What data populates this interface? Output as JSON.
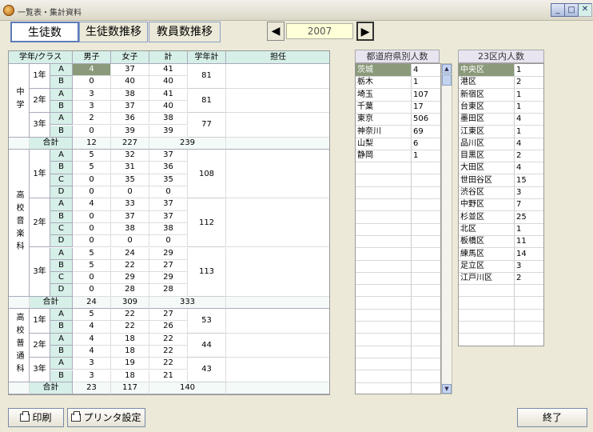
{
  "window": {
    "title": "一覧表・集計資料"
  },
  "tabs": [
    {
      "label": "生徒数"
    },
    {
      "label": "生徒数推移"
    },
    {
      "label": "教員数推移"
    }
  ],
  "year": {
    "value": "2007"
  },
  "grid": {
    "headers": {
      "year_class": "学年/クラス",
      "boys": "男子",
      "girls": "女子",
      "total": "計",
      "grade_total": "学年計",
      "teacher": "担任"
    },
    "sections": [
      {
        "label": "中学",
        "rows": [
          {
            "year": "1年",
            "class": "A",
            "boys": "4",
            "girls": "37",
            "total": "41"
          },
          {
            "year": "1年",
            "class": "B",
            "boys": "0",
            "girls": "40",
            "total": "40"
          },
          {
            "year": "2年",
            "class": "A",
            "boys": "3",
            "girls": "38",
            "total": "41"
          },
          {
            "year": "2年",
            "class": "B",
            "boys": "3",
            "girls": "37",
            "total": "40"
          },
          {
            "year": "3年",
            "class": "A",
            "boys": "2",
            "girls": "36",
            "total": "38"
          },
          {
            "year": "3年",
            "class": "B",
            "boys": "0",
            "girls": "39",
            "total": "39"
          }
        ],
        "grade_totals": [
          "81",
          "81",
          "77"
        ],
        "sum": {
          "label": "合計",
          "boys": "12",
          "girls": "227",
          "total": "239"
        }
      },
      {
        "label": "高校音楽科",
        "rows": [
          {
            "class": "A",
            "boys": "5",
            "girls": "32",
            "total": "37"
          },
          {
            "class": "B",
            "boys": "5",
            "girls": "31",
            "total": "36"
          },
          {
            "class": "C",
            "boys": "0",
            "girls": "35",
            "total": "35"
          },
          {
            "class": "D",
            "boys": "0",
            "girls": "0",
            "total": "0"
          },
          {
            "class": "A",
            "boys": "4",
            "girls": "33",
            "total": "37"
          },
          {
            "class": "B",
            "boys": "0",
            "girls": "37",
            "total": "37"
          },
          {
            "class": "C",
            "boys": "0",
            "girls": "38",
            "total": "38"
          },
          {
            "class": "D",
            "boys": "0",
            "girls": "0",
            "total": "0"
          },
          {
            "class": "A",
            "boys": "5",
            "girls": "24",
            "total": "29"
          },
          {
            "class": "B",
            "boys": "5",
            "girls": "22",
            "total": "27"
          },
          {
            "class": "C",
            "boys": "0",
            "girls": "29",
            "total": "29"
          },
          {
            "class": "D",
            "boys": "0",
            "girls": "28",
            "total": "28"
          }
        ],
        "years": [
          "1年",
          "2年",
          "3年"
        ],
        "grade_totals": [
          "108",
          "112",
          "113"
        ],
        "sum": {
          "label": "合計",
          "boys": "24",
          "girls": "309",
          "total": "333"
        }
      },
      {
        "label": "高校普通科",
        "rows": [
          {
            "class": "A",
            "boys": "5",
            "girls": "22",
            "total": "27"
          },
          {
            "class": "B",
            "boys": "4",
            "girls": "22",
            "total": "26"
          },
          {
            "class": "A",
            "boys": "4",
            "girls": "18",
            "total": "22"
          },
          {
            "class": "B",
            "boys": "4",
            "girls": "18",
            "total": "22"
          },
          {
            "class": "A",
            "boys": "3",
            "girls": "19",
            "total": "22"
          },
          {
            "class": "B",
            "boys": "3",
            "girls": "18",
            "total": "21"
          }
        ],
        "years": [
          "1年",
          "2年",
          "3年"
        ],
        "grade_totals": [
          "53",
          "44",
          "43"
        ],
        "sum": {
          "label": "合計",
          "boys": "23",
          "girls": "117",
          "total": "140"
        }
      }
    ]
  },
  "prefectures": {
    "header": "都道府県別人数",
    "items": [
      {
        "name": "茨城",
        "count": "4"
      },
      {
        "name": "栃木",
        "count": "1"
      },
      {
        "name": "埼玉",
        "count": "107"
      },
      {
        "name": "千葉",
        "count": "17"
      },
      {
        "name": "東京",
        "count": "506"
      },
      {
        "name": "神奈川",
        "count": "69"
      },
      {
        "name": "山梨",
        "count": "6"
      },
      {
        "name": "静岡",
        "count": "1"
      }
    ]
  },
  "wards": {
    "header": "23区内人数",
    "items": [
      {
        "name": "中央区",
        "count": "1"
      },
      {
        "name": "港区",
        "count": "2"
      },
      {
        "name": "新宿区",
        "count": "1"
      },
      {
        "name": "台東区",
        "count": "1"
      },
      {
        "name": "墨田区",
        "count": "4"
      },
      {
        "name": "江東区",
        "count": "1"
      },
      {
        "name": "品川区",
        "count": "4"
      },
      {
        "name": "目黒区",
        "count": "2"
      },
      {
        "name": "大田区",
        "count": "4"
      },
      {
        "name": "世田谷区",
        "count": "15"
      },
      {
        "name": "渋谷区",
        "count": "3"
      },
      {
        "name": "中野区",
        "count": "7"
      },
      {
        "name": "杉並区",
        "count": "25"
      },
      {
        "name": "北区",
        "count": "1"
      },
      {
        "name": "板橋区",
        "count": "11"
      },
      {
        "name": "練馬区",
        "count": "14"
      },
      {
        "name": "足立区",
        "count": "3"
      },
      {
        "name": "江戸川区",
        "count": "2"
      }
    ]
  },
  "buttons": {
    "print": "印刷",
    "printer_settings": "プリンタ設定",
    "exit": "終了"
  },
  "icons": {
    "prev": "arrow-left-icon",
    "next": "arrow-right-icon",
    "print": "printer-icon"
  },
  "colors": {
    "header_bg": "#d6efe8",
    "selected_bg": "#8a9a7a",
    "year_box_bg": "#ffffd8"
  }
}
